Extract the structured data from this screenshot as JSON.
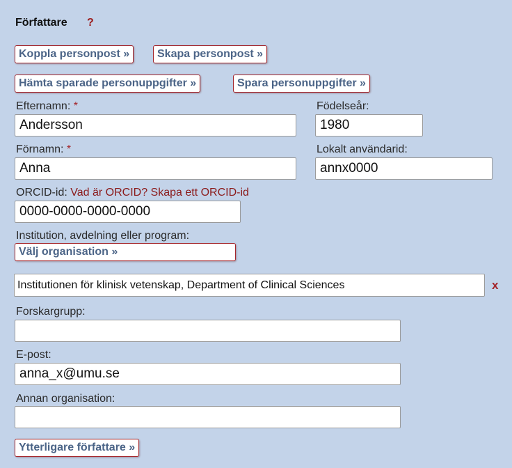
{
  "section": {
    "title": "Författare",
    "help": "?"
  },
  "buttons": {
    "link_person": "Koppla personpost »",
    "create_person": "Skapa personpost »",
    "fetch_saved": "Hämta sparade personuppgifter »",
    "save_details": "Spara personuppgifter »",
    "choose_org": "Välj organisation »",
    "more_authors": "Ytterligare författare »"
  },
  "fields": {
    "last_name": {
      "label": "Efternamn:",
      "required": "*",
      "value": "Andersson"
    },
    "birth_year": {
      "label": "Födelseår:",
      "value": "1980"
    },
    "first_name": {
      "label": "Förnamn:",
      "required": "*",
      "value": "Anna"
    },
    "local_user_id": {
      "label": "Lokalt användarid:",
      "value": "annx0000"
    },
    "orcid": {
      "label": "ORCID-id:",
      "link_what": "Vad är ORCID?",
      "link_create": "Skapa ett ORCID-id",
      "value": "0000-0000-0000-0000"
    },
    "institution": {
      "label": "Institution, avdelning eller program:",
      "value": "Institutionen för klinisk vetenskap, Department of Clinical Sciences",
      "remove": "x"
    },
    "research_group": {
      "label": "Forskargrupp:",
      "value": ""
    },
    "email": {
      "label": "E-post:",
      "value": "anna_x@umu.se"
    },
    "other_org": {
      "label": "Annan organisation:",
      "value": ""
    }
  },
  "colors": {
    "background": "#c3d3e9",
    "button_border": "#a4262c",
    "button_text": "#4b6487",
    "required": "#a4262c",
    "link": "#8b1a1a"
  }
}
